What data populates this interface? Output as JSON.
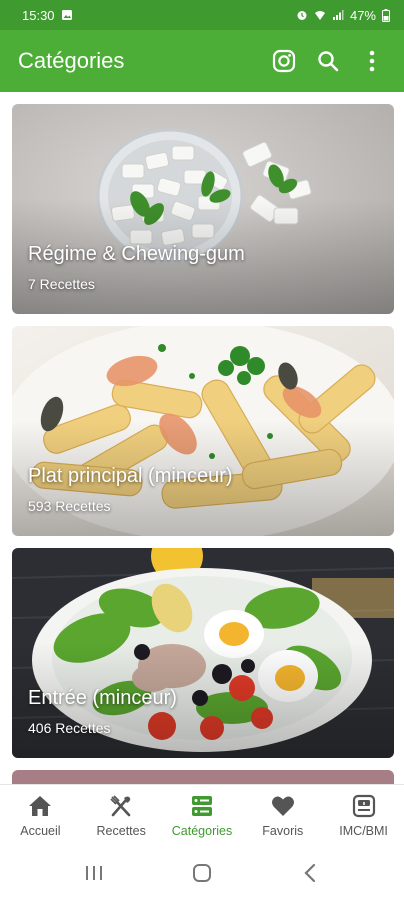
{
  "status_bar": {
    "time": "15:30",
    "battery": "47%"
  },
  "app_bar": {
    "title": "Catégories",
    "actions": [
      "instagram-icon",
      "search-icon",
      "more-vert-icon"
    ]
  },
  "categories": [
    {
      "title": "Régime & Chewing-gum",
      "count": "7 Recettes"
    },
    {
      "title": "Plat principal (minceur)",
      "count": "593 Recettes"
    },
    {
      "title": "Entrée (minceur)",
      "count": "406 Recettes"
    }
  ],
  "bottom_nav": {
    "items": [
      {
        "label": "Accueil",
        "icon": "home-icon"
      },
      {
        "label": "Recettes",
        "icon": "cutlery-icon"
      },
      {
        "label": "Catégories",
        "icon": "categories-icon",
        "active": true
      },
      {
        "label": "Favoris",
        "icon": "heart-icon"
      },
      {
        "label": "IMC/BMI",
        "icon": "scale-icon"
      }
    ]
  },
  "colors": {
    "primary": "#4cad37",
    "status_bar": "#3f9a2f",
    "active_nav": "#3f9a2f",
    "inactive_nav": "#555555"
  }
}
